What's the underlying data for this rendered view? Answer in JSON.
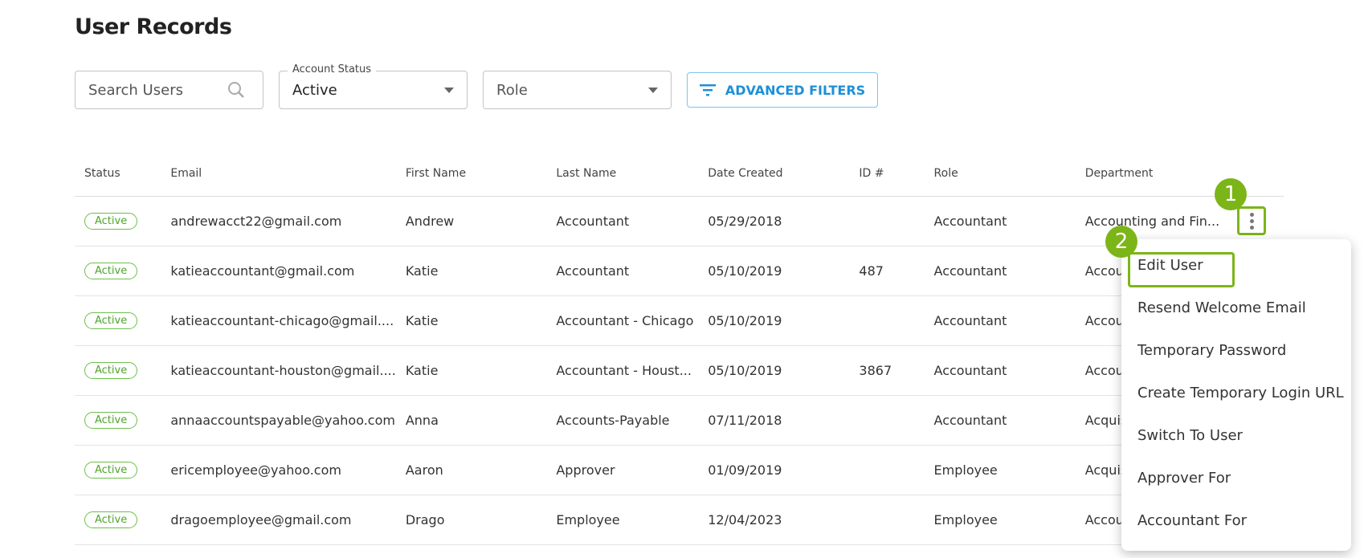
{
  "page_title": "User Records",
  "filters": {
    "search_placeholder": "Search Users",
    "account_status_label": "Account Status",
    "account_status_value": "Active",
    "role_placeholder": "Role",
    "advanced_filters": "ADVANCED FILTERS"
  },
  "table": {
    "headers": [
      "Status",
      "Email",
      "First Name",
      "Last Name",
      "Date Created",
      "ID #",
      "Role",
      "Department"
    ],
    "rows": [
      [
        "Active",
        "andrewacct22@gmail.com",
        "Andrew",
        "Accountant",
        "05/29/2018",
        "",
        "Accountant",
        "Accounting and Fin..."
      ],
      [
        "Active",
        "katieaccountant@gmail.com",
        "Katie",
        "Accountant",
        "05/10/2019",
        "487",
        "Accountant",
        "Accou"
      ],
      [
        "Active",
        "katieaccountant-chicago@gmail....",
        "Katie",
        "Accountant - Chicago",
        "05/10/2019",
        "",
        "Accountant",
        "Accou"
      ],
      [
        "Active",
        "katieaccountant-houston@gmail....",
        "Katie",
        "Accountant - Houst...",
        "05/10/2019",
        "3867",
        "Accountant",
        "Accou"
      ],
      [
        "Active",
        "annaaccountspayable@yahoo.com",
        "Anna",
        "Accounts-Payable",
        "07/11/2018",
        "",
        "Accountant",
        "Acquis"
      ],
      [
        "Active",
        "ericemployee@yahoo.com",
        "Aaron",
        "Approver",
        "01/09/2019",
        "",
        "Employee",
        "Acquis"
      ],
      [
        "Active",
        "dragoemployee@gmail.com",
        "Drago",
        "Employee",
        "12/04/2023",
        "",
        "Employee",
        "Accou"
      ]
    ]
  },
  "menu": [
    "Edit User",
    "Resend Welcome Email",
    "Temporary Password",
    "Create Temporary Login URL",
    "Switch To User",
    "Approver For",
    "Accountant For"
  ],
  "step_markers": [
    "1",
    "2"
  ],
  "colors": {
    "accent": "#1e90d6",
    "highlight": "#7cb518",
    "status_active": "#4ca52a"
  }
}
